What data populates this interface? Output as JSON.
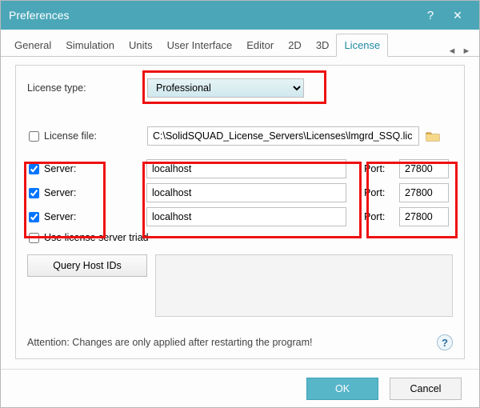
{
  "title": "Preferences",
  "tabs": {
    "general": "General",
    "simulation": "Simulation",
    "units": "Units",
    "ui": "User Interface",
    "editor": "Editor",
    "two_d": "2D",
    "three_d": "3D",
    "license": "License"
  },
  "license": {
    "type_label": "License type:",
    "type_value": "Professional",
    "file_label": "License file:",
    "file_value": "C:\\SolidSQUAD_License_Servers\\Licenses\\lmgrd_SSQ.lic",
    "server_label": "Server:",
    "port_label": "Port:",
    "servers": [
      {
        "checked": true,
        "host": "localhost",
        "port": "27800"
      },
      {
        "checked": true,
        "host": "localhost",
        "port": "27800"
      },
      {
        "checked": true,
        "host": "localhost",
        "port": "27800"
      }
    ],
    "triad_label": "Use license server triad",
    "triad_checked": false,
    "query_btn": "Query Host IDs",
    "attention": "Attention: Changes are only applied after restarting the program!"
  },
  "buttons": {
    "ok": "OK",
    "cancel": "Cancel"
  }
}
